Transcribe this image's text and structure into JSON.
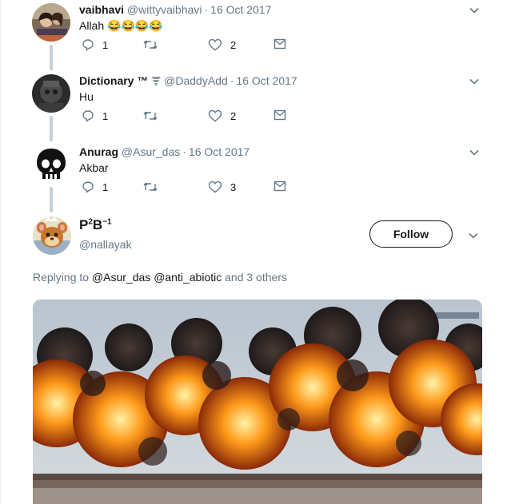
{
  "tweets": [
    {
      "name": "vaibhavi",
      "handle": "@wittyvaibhavi",
      "date": "16 Oct 2017",
      "text": "Allah 😂😂😂😂",
      "reply_count": "1",
      "like_count": "2"
    },
    {
      "name": "Dictionary ™",
      "handle": "@DaddyAdd",
      "date": "16 Oct 2017",
      "text": "Hu",
      "reply_count": "1",
      "like_count": "2"
    },
    {
      "name": "Anurag",
      "handle": "@Asur_das",
      "date": "16 Oct 2017",
      "text": "Akbar",
      "reply_count": "1",
      "like_count": "3"
    }
  ],
  "main_tweet": {
    "name_base1": "P",
    "name_sup1": "2",
    "name_base2": "B",
    "name_sup2": "−1",
    "handle": "@nallayak",
    "follow_label": "Follow",
    "replying_prefix": "Replying to",
    "mention1": "@Asur_das",
    "mention2": "@anti_abiotic",
    "replying_suffix": "and 3 others"
  },
  "icons": [
    "reply-icon",
    "retweet-icon",
    "like-icon",
    "direct-message-icon",
    "chevron-down-icon"
  ],
  "colors": {
    "text": "#14171a",
    "secondary": "#657786",
    "thread_line": "#c4cfd6",
    "border": "#e6ecf0"
  }
}
